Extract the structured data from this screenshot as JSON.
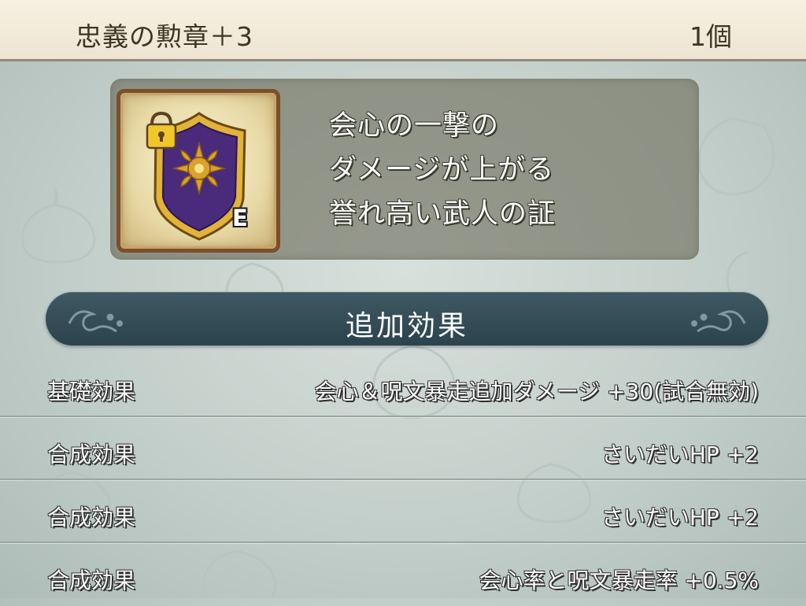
{
  "item": {
    "name": "忠義の勲章＋3",
    "count": "1個",
    "icon": "shield-medal-icon",
    "locked": true,
    "equipped_badge": "E"
  },
  "description": {
    "lines": [
      "会心の一撃の",
      "ダメージが上がる",
      "誉れ高い武人の証"
    ]
  },
  "effects": {
    "header": "追加効果",
    "rows": [
      {
        "label": "基礎効果",
        "value": "会心＆呪文暴走追加ダメージ +30(試合無効)"
      },
      {
        "label": "合成効果",
        "value": "さいだいHP +2"
      },
      {
        "label": "合成効果",
        "value": "さいだいHP +2"
      },
      {
        "label": "合成効果",
        "value": "会心率と呪文暴走率 +0.5%"
      }
    ]
  },
  "colors": {
    "header_bar": "#2f4852",
    "title_bar": "#f3ecdb",
    "panel": "#6c6c5a",
    "shield_purple": "#4a2a7a",
    "shield_gold": "#e2b33a"
  }
}
